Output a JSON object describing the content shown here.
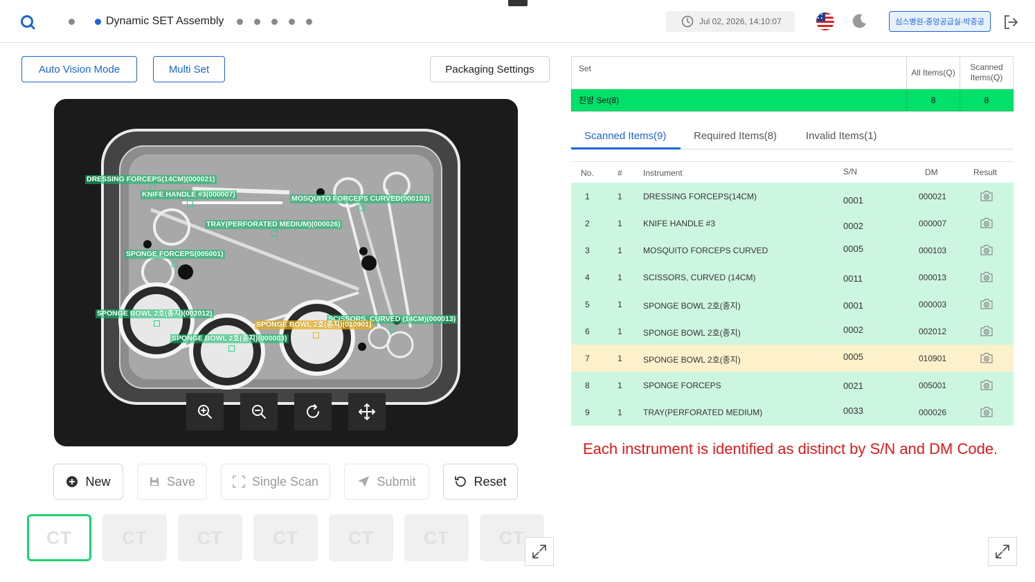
{
  "header": {
    "title": "Dynamic SET Assembly",
    "datetime": "Jul 02, 2026, 14:10:07",
    "user": "심스병원-중앙공급실-박중공"
  },
  "modes": {
    "auto_vision": "Auto Vision Mode",
    "multi_set": "Multi Set",
    "packaging": "Packaging Settings"
  },
  "detections": [
    {
      "label": "DRESSING FORCEPS(14CM)(000021)",
      "status": "ok"
    },
    {
      "label": "KNIFE HANDLE #3(000007)",
      "status": "ok"
    },
    {
      "label": "MOSQUITO FORCEPS CURVED(000103)",
      "status": "ok"
    },
    {
      "label": "TRAY(PERFORATED MEDIUM)(000026)",
      "status": "ok"
    },
    {
      "label": "SPONGE FORCEPS(005001)",
      "status": "ok"
    },
    {
      "label": "SPONGE BOWL 2호(종지)(002012)",
      "status": "ok"
    },
    {
      "label": "SCISSORS, CURVED (14CM)(000013)",
      "status": "ok"
    },
    {
      "label": "SPONGE BOWL 2호(종지)(010901)",
      "status": "warn"
    },
    {
      "label": "SPONGE BOWL 2호(종지)(000003)",
      "status": "ok"
    }
  ],
  "actions": {
    "new": "New",
    "save": "Save",
    "single_scan": "Single Scan",
    "submit": "Submit",
    "reset": "Reset"
  },
  "ct_tiles": [
    "CT",
    "CT",
    "CT",
    "CT",
    "CT",
    "CT",
    "CT"
  ],
  "set_table": {
    "headers": {
      "set": "Set",
      "all": "All Items(Q)",
      "scanned": "Scanned Items(Q)"
    },
    "row": {
      "name": "진방 Set(8)",
      "all": "8",
      "scanned": "8"
    }
  },
  "tabs": [
    "Scanned Items(9)",
    "Required Items(8)",
    "Invalid Items(1)"
  ],
  "items_table": {
    "headers": {
      "no": "No.",
      "count": "#",
      "instrument": "Instrument",
      "sn": "S/N",
      "dm": "DM",
      "result": "Result"
    },
    "rows": [
      {
        "no": "1",
        "count": "1",
        "instrument": "DRESSING FORCEPS(14CM)",
        "sn": "0001",
        "dm": "000021",
        "status": "ok"
      },
      {
        "no": "2",
        "count": "1",
        "instrument": "KNIFE HANDLE #3",
        "sn": "0002",
        "dm": "000007",
        "status": "ok"
      },
      {
        "no": "3",
        "count": "1",
        "instrument": "MOSQUITO FORCEPS CURVED",
        "sn": "0005",
        "dm": "000103",
        "status": "ok"
      },
      {
        "no": "4",
        "count": "1",
        "instrument": "SCISSORS, CURVED (14CM)",
        "sn": "0011",
        "dm": "000013",
        "status": "ok"
      },
      {
        "no": "5",
        "count": "1",
        "instrument": "SPONGE BOWL 2호(종지)",
        "sn": "0001",
        "dm": "000003",
        "status": "ok"
      },
      {
        "no": "6",
        "count": "1",
        "instrument": "SPONGE BOWL 2호(종지)",
        "sn": "0002",
        "dm": "002012",
        "status": "ok"
      },
      {
        "no": "7",
        "count": "1",
        "instrument": "SPONGE BOWL 2호(종지)",
        "sn": "0005",
        "dm": "010901",
        "status": "warn"
      },
      {
        "no": "8",
        "count": "1",
        "instrument": "SPONGE FORCEPS",
        "sn": "0021",
        "dm": "005001",
        "status": "ok"
      },
      {
        "no": "9",
        "count": "1",
        "instrument": "TRAY(PERFORATED MEDIUM)",
        "sn": "0033",
        "dm": "000026",
        "status": "ok"
      }
    ]
  },
  "note": "Each instrument is identified as distinct by S/N and DM Code.",
  "colors": {
    "accent": "#1a63d8",
    "ok": "#00e06a",
    "ok_row": "#cdf6e0",
    "warn_row": "#fdf1cc",
    "note": "#e0181c"
  }
}
